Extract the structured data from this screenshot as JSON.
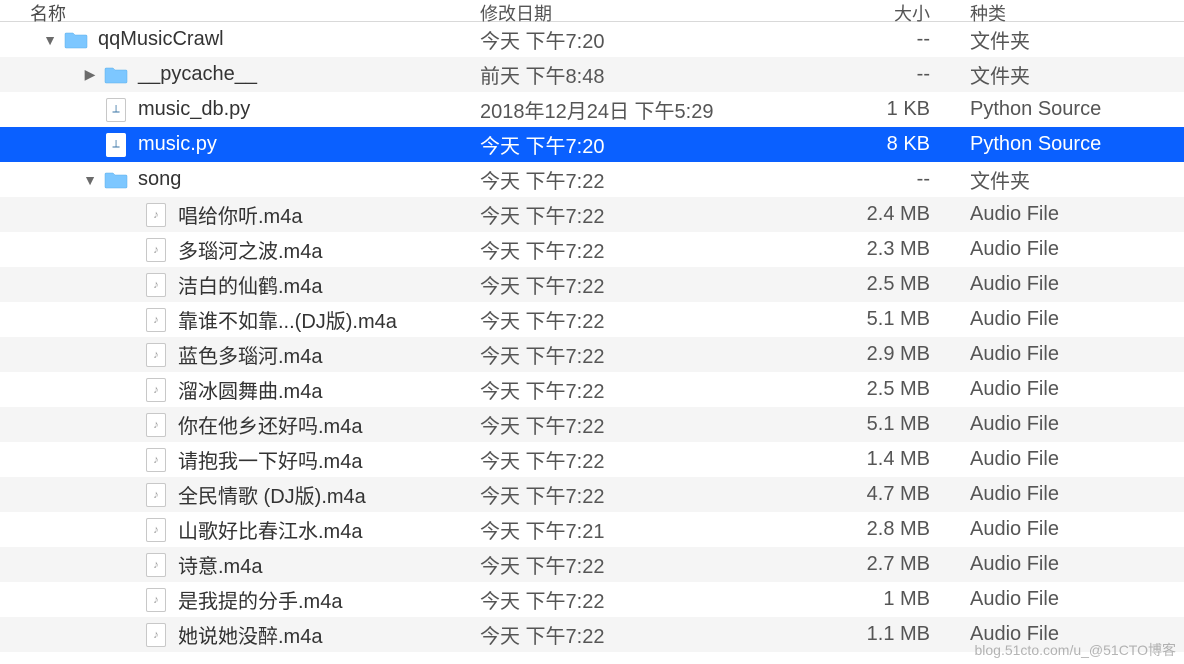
{
  "columns": {
    "name": "名称",
    "date": "修改日期",
    "size": "大小",
    "kind": "种类"
  },
  "rows": [
    {
      "indent": 0,
      "disclosure": "down",
      "iconType": "folder",
      "name": "qqMusicCrawl",
      "date": "今天 下午7:20",
      "size": "--",
      "kind": "文件夹",
      "selected": false
    },
    {
      "indent": 1,
      "disclosure": "right",
      "iconType": "folder",
      "name": "__pycache__",
      "date": "前天 下午8:48",
      "size": "--",
      "kind": "文件夹",
      "selected": false
    },
    {
      "indent": 1,
      "disclosure": "none",
      "iconType": "python",
      "name": "music_db.py",
      "date": "2018年12月24日 下午5:29",
      "size": "1 KB",
      "kind": "Python Source",
      "selected": false
    },
    {
      "indent": 1,
      "disclosure": "none",
      "iconType": "python",
      "name": "music.py",
      "date": "今天 下午7:20",
      "size": "8 KB",
      "kind": "Python Source",
      "selected": true
    },
    {
      "indent": 1,
      "disclosure": "down",
      "iconType": "folder",
      "name": "song",
      "date": "今天 下午7:22",
      "size": "--",
      "kind": "文件夹",
      "selected": false
    },
    {
      "indent": 2,
      "disclosure": "none",
      "iconType": "audio",
      "name": "唱给你听.m4a",
      "date": "今天 下午7:22",
      "size": "2.4 MB",
      "kind": "Audio File",
      "selected": false
    },
    {
      "indent": 2,
      "disclosure": "none",
      "iconType": "audio",
      "name": "多瑙河之波.m4a",
      "date": "今天 下午7:22",
      "size": "2.3 MB",
      "kind": "Audio File",
      "selected": false
    },
    {
      "indent": 2,
      "disclosure": "none",
      "iconType": "audio",
      "name": "洁白的仙鹤.m4a",
      "date": "今天 下午7:22",
      "size": "2.5 MB",
      "kind": "Audio File",
      "selected": false
    },
    {
      "indent": 2,
      "disclosure": "none",
      "iconType": "audio",
      "name": "靠谁不如靠...(DJ版).m4a",
      "date": "今天 下午7:22",
      "size": "5.1 MB",
      "kind": "Audio File",
      "selected": false
    },
    {
      "indent": 2,
      "disclosure": "none",
      "iconType": "audio",
      "name": "蓝色多瑙河.m4a",
      "date": "今天 下午7:22",
      "size": "2.9 MB",
      "kind": "Audio File",
      "selected": false
    },
    {
      "indent": 2,
      "disclosure": "none",
      "iconType": "audio",
      "name": "溜冰圆舞曲.m4a",
      "date": "今天 下午7:22",
      "size": "2.5 MB",
      "kind": "Audio File",
      "selected": false
    },
    {
      "indent": 2,
      "disclosure": "none",
      "iconType": "audio",
      "name": "你在他乡还好吗.m4a",
      "date": "今天 下午7:22",
      "size": "5.1 MB",
      "kind": "Audio File",
      "selected": false
    },
    {
      "indent": 2,
      "disclosure": "none",
      "iconType": "audio",
      "name": "请抱我一下好吗.m4a",
      "date": "今天 下午7:22",
      "size": "1.4 MB",
      "kind": "Audio File",
      "selected": false
    },
    {
      "indent": 2,
      "disclosure": "none",
      "iconType": "audio",
      "name": "全民情歌 (DJ版).m4a",
      "date": "今天 下午7:22",
      "size": "4.7 MB",
      "kind": "Audio File",
      "selected": false
    },
    {
      "indent": 2,
      "disclosure": "none",
      "iconType": "audio",
      "name": "山歌好比春江水.m4a",
      "date": "今天 下午7:21",
      "size": "2.8 MB",
      "kind": "Audio File",
      "selected": false
    },
    {
      "indent": 2,
      "disclosure": "none",
      "iconType": "audio",
      "name": "诗意.m4a",
      "date": "今天 下午7:22",
      "size": "2.7 MB",
      "kind": "Audio File",
      "selected": false
    },
    {
      "indent": 2,
      "disclosure": "none",
      "iconType": "audio",
      "name": "是我提的分手.m4a",
      "date": "今天 下午7:22",
      "size": "1 MB",
      "kind": "Audio File",
      "selected": false
    },
    {
      "indent": 2,
      "disclosure": "none",
      "iconType": "audio",
      "name": "她说她没醉.m4a",
      "date": "今天 下午7:22",
      "size": "1.1 MB",
      "kind": "Audio File",
      "selected": false
    }
  ],
  "watermark": "blog.51cto.com/u_@51CTO博客"
}
